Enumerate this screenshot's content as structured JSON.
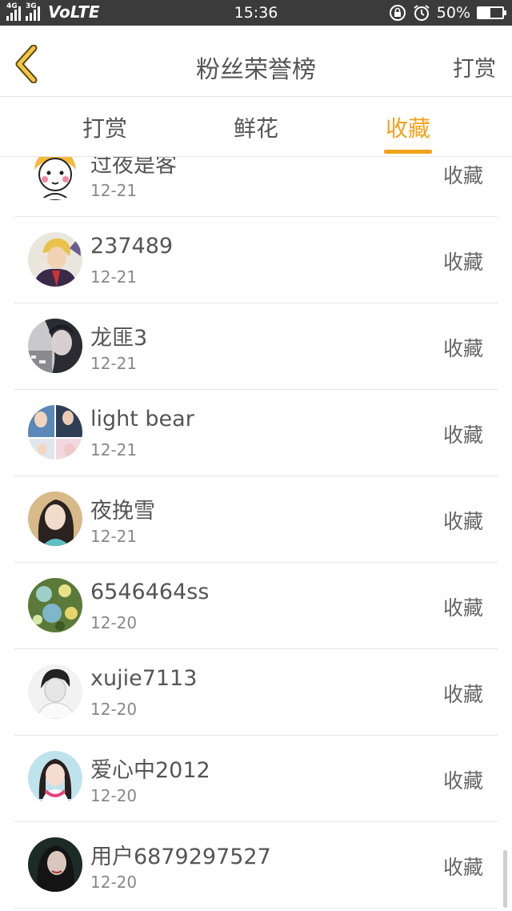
{
  "status_bar": {
    "net1": "4G",
    "net2": "3G",
    "volte": "VoLTE",
    "time": "15:36",
    "battery": "50%",
    "battery_level": 0.5
  },
  "header": {
    "title": "粉丝荣誉榜",
    "right_action": "打赏"
  },
  "tabs": [
    {
      "label": "打赏",
      "active": false
    },
    {
      "label": "鲜花",
      "active": false
    },
    {
      "label": "收藏",
      "active": true
    }
  ],
  "colors": {
    "accent": "#f2a31b",
    "status_bar": "#3b3b3b"
  },
  "list": [
    {
      "name": "过夜是客",
      "date": "12-21",
      "action": "收藏",
      "avatar": "cartoon-girl-avatar"
    },
    {
      "name": "237489",
      "date": "12-21",
      "action": "收藏",
      "avatar": "anime-boy-avatar"
    },
    {
      "name": "龙匪3",
      "date": "12-21",
      "action": "收藏",
      "avatar": "dark-portrait-avatar"
    },
    {
      "name": "light bear",
      "date": "12-21",
      "action": "收藏",
      "avatar": "collage-avatar"
    },
    {
      "name": "夜挽雪",
      "date": "12-21",
      "action": "收藏",
      "avatar": "girl-portrait-avatar"
    },
    {
      "name": "6546464ss",
      "date": "12-20",
      "action": "收藏",
      "avatar": "flowers-avatar"
    },
    {
      "name": "xujie7113",
      "date": "12-20",
      "action": "收藏",
      "avatar": "bw-portrait-avatar"
    },
    {
      "name": "爱心中2012",
      "date": "12-20",
      "action": "收藏",
      "avatar": "pink-girl-avatar"
    },
    {
      "name": "用户6879297527",
      "date": "12-20",
      "action": "收藏",
      "avatar": "dark-girl-avatar"
    }
  ]
}
